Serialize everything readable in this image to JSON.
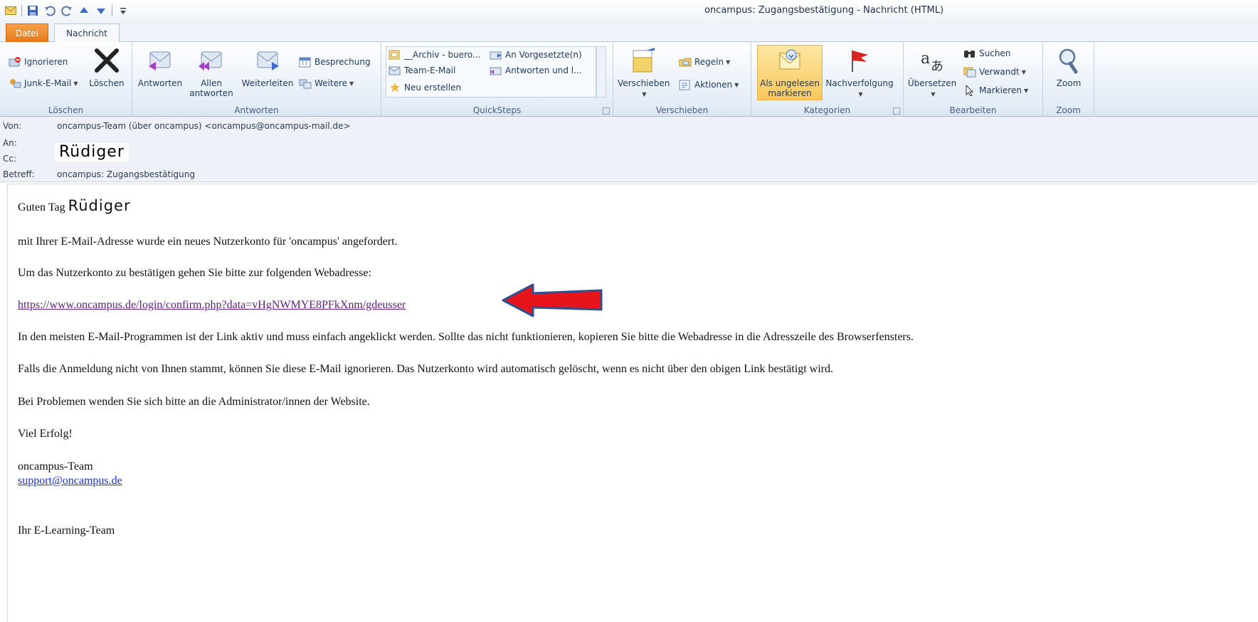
{
  "window": {
    "title": "oncampus: Zugangsbestätigung - Nachricht (HTML)"
  },
  "tabs": {
    "file": "Datei",
    "message": "Nachricht"
  },
  "ribbon": {
    "loeschen": {
      "ignore": "Ignorieren",
      "junk": "Junk-E-Mail",
      "delete": "Löschen",
      "label": "Löschen"
    },
    "antworten": {
      "reply": "Antworten",
      "reply_all_1": "Allen",
      "reply_all_2": "antworten",
      "forward": "Weiterleiten",
      "meeting": "Besprechung",
      "more": "Weitere",
      "label": "Antworten"
    },
    "quicksteps": {
      "archive": "__Archiv - buero...",
      "team": "Team-E-Mail",
      "new": "Neu erstellen",
      "to_manager": "An Vorgesetzte(n)",
      "reply_delete": "Antworten und l...",
      "label": "QuickSteps"
    },
    "verschieben": {
      "move": "Verschieben",
      "rules": "Regeln",
      "actions": "Aktionen",
      "label": "Verschieben"
    },
    "kategorien": {
      "unread_1": "Als ungelesen",
      "unread_2": "markieren",
      "followup": "Nachverfolgung",
      "label": "Kategorien"
    },
    "bearbeiten": {
      "translate": "Übersetzen",
      "find": "Suchen",
      "related": "Verwandt",
      "select": "Markieren",
      "label": "Bearbeiten"
    },
    "zoom": {
      "zoom": "Zoom",
      "label": "Zoom"
    }
  },
  "header": {
    "from_label": "Von:",
    "from_value": "oncampus-Team  (über oncampus) <oncampus@oncampus-mail.de>",
    "to_label": "An:",
    "to_value": "Rüdiger",
    "cc_label": "Cc:",
    "subject_label": "Betreff:",
    "subject_value": "oncampus: Zugangsbestätigung"
  },
  "message": {
    "greeting": "Guten Tag",
    "greeting_name": "Rüdiger",
    "p1": "mit Ihrer E-Mail-Adresse wurde ein neues Nutzerkonto für 'oncampus' angefordert.",
    "p2": "Um das Nutzerkonto zu bestätigen gehen Sie bitte zur folgenden Webadresse:",
    "link": "https://www.oncampus.de/login/confirm.php?data=vHgNWMYE8PFkXnm/gdeusser",
    "p3": "In den meisten E-Mail-Programmen ist der Link aktiv und muss einfach angeklickt werden. Sollte das nicht funktionieren, kopieren Sie bitte die Webadresse in die Adresszeile des Browserfensters.",
    "p4": "Falls die Anmeldung nicht von Ihnen stammt, können Sie diese E-Mail ignorieren. Das Nutzerkonto wird automatisch gelöscht, wenn es nicht über den obigen Link bestätigt wird.",
    "p5": "Bei Problemen wenden Sie sich bitte an die Administrator/innen der Website.",
    "p6": "Viel Erfolg!",
    "sig1": "oncampus-Team",
    "support_email": "support@oncampus.de",
    "sig2": "Ihr E-Learning-Team"
  },
  "colors": {
    "arrow": "#e8141b",
    "file_tab": "#e5781c",
    "visited_link": "#5b1d7a",
    "link": "#1a2fd0"
  },
  "icons": [
    "mail-icon",
    "save-icon",
    "undo-icon",
    "redo-icon",
    "up-icon",
    "down-icon",
    "ignore-icon",
    "junk-icon",
    "delete-icon",
    "reply-icon",
    "reply-all-icon",
    "forward-icon",
    "meeting-icon",
    "more-icon",
    "archive-icon",
    "team-email-icon",
    "new-quickstep-icon",
    "to-manager-icon",
    "reply-delete-icon",
    "move-icon",
    "rules-icon",
    "actions-icon",
    "unread-icon",
    "flag-icon",
    "translate-icon",
    "find-icon",
    "related-icon",
    "select-icon",
    "zoom-icon",
    "arrow-icon"
  ]
}
